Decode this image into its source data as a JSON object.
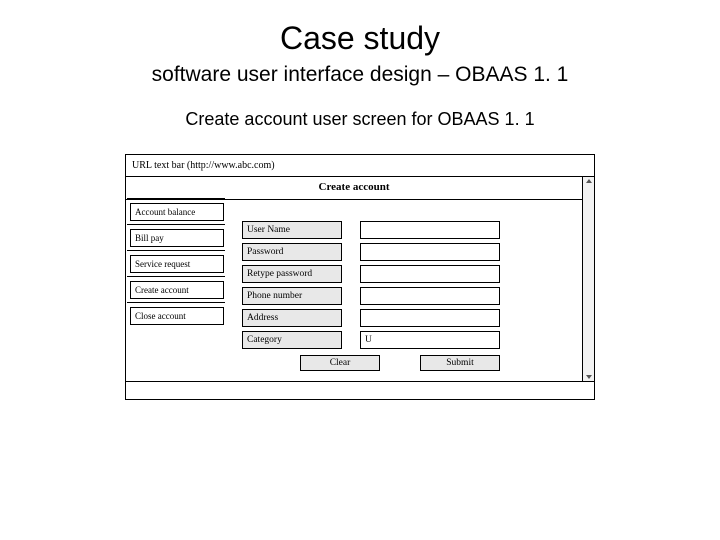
{
  "slide": {
    "title": "Case study",
    "subtitle": "software user interface design – OBAAS 1. 1",
    "caption": "Create account user screen for OBAAS 1. 1"
  },
  "mockup": {
    "url_label": "URL text bar (http://www.abc.com)",
    "page_heading": "Create account",
    "sidebar": [
      "Account balance",
      "Bill pay",
      "Service request",
      "Create account",
      "Close account"
    ],
    "fields": [
      {
        "label": "User Name",
        "value": ""
      },
      {
        "label": "Password",
        "value": ""
      },
      {
        "label": "Retype password",
        "value": ""
      },
      {
        "label": "Phone number",
        "value": ""
      },
      {
        "label": "Address",
        "value": ""
      },
      {
        "label": "Category",
        "value": "U"
      }
    ],
    "buttons": {
      "clear": "Clear",
      "submit": "Submit"
    }
  }
}
